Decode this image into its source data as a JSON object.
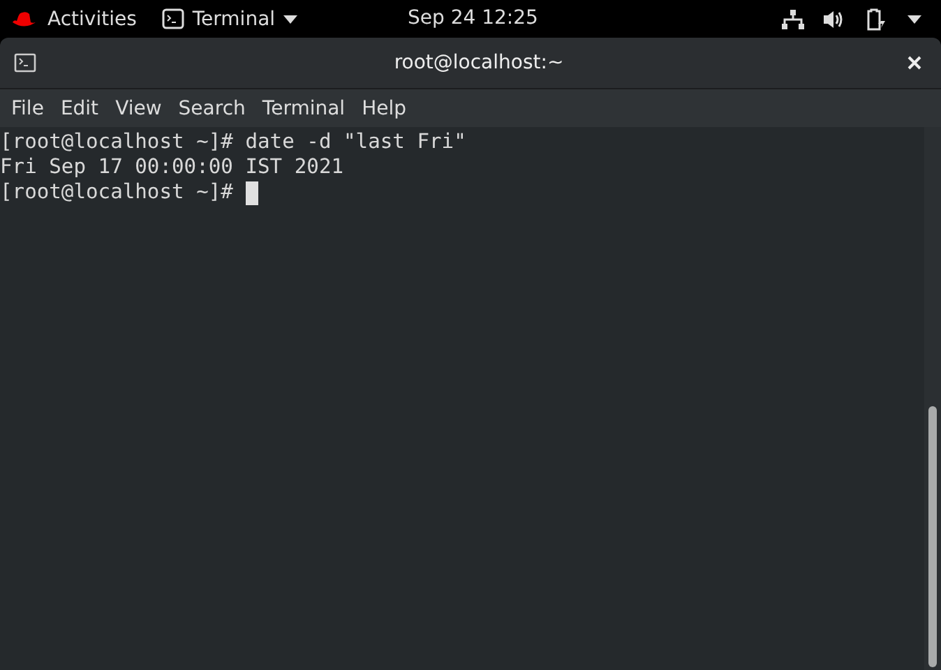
{
  "top_bar": {
    "activities": "Activities",
    "app_menu": "Terminal",
    "clock": "Sep 24  12:25"
  },
  "window": {
    "title": "root@localhost:~"
  },
  "menu": [
    "File",
    "Edit",
    "View",
    "Search",
    "Terminal",
    "Help"
  ],
  "terminal": {
    "lines": [
      {
        "text": "[root@localhost ~]# date -d \"last Fri\"",
        "cursor": false
      },
      {
        "text": "Fri Sep 17 00:00:00 IST 2021",
        "cursor": false
      },
      {
        "text": "[root@localhost ~]# ",
        "cursor": true
      }
    ]
  }
}
